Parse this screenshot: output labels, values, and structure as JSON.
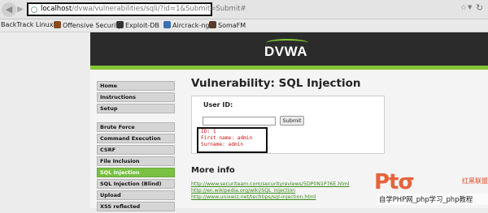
{
  "browser": {
    "url_host": "localhost",
    "url_path": "/dvwa/vulnerabilities/sqli/?id=1&Submit=Submit#",
    "bookmarks": [
      {
        "label": "BackTrack Linux",
        "color": "#ffffff"
      },
      {
        "label": "Offensive Security",
        "color": "#8a4a1a"
      },
      {
        "label": "Exploit-DB",
        "color": "#333333"
      },
      {
        "label": "Aircrack-ng",
        "color": "#3b6fb0"
      },
      {
        "label": "SomaFM",
        "color": "#5a3a2a"
      }
    ]
  },
  "dvwa": {
    "logo": "DVWA",
    "accent_color": "#82c434",
    "menu": [
      "Home",
      "Instructions",
      "Setup",
      "Brute Force",
      "Command Execution",
      "CSRF",
      "File Inclusion",
      "SQL Injection",
      "SQL Injection (Blind)",
      "Upload",
      "XSS reflected"
    ],
    "active_menu": "SQL Injection"
  },
  "main": {
    "title": "Vulnerability: SQL Injection",
    "userid_label": "User ID:",
    "userid_value": "",
    "submit_label": "Submit",
    "result": [
      "ID: 1",
      "First name: admin",
      "Surname: admin"
    ],
    "more_info_title": "More info",
    "links": [
      "http://www.securiteam.com/securityreviews/5DP0N1P76E.html",
      "http://en.wikipedia.org/wiki/SQL_injection",
      "http://www.unixwiz.net/techtips/sql-injection.html"
    ]
  },
  "watermark": {
    "side_text": "红黑联盟",
    "caption": "自学PHP网_php学习_php教程"
  }
}
